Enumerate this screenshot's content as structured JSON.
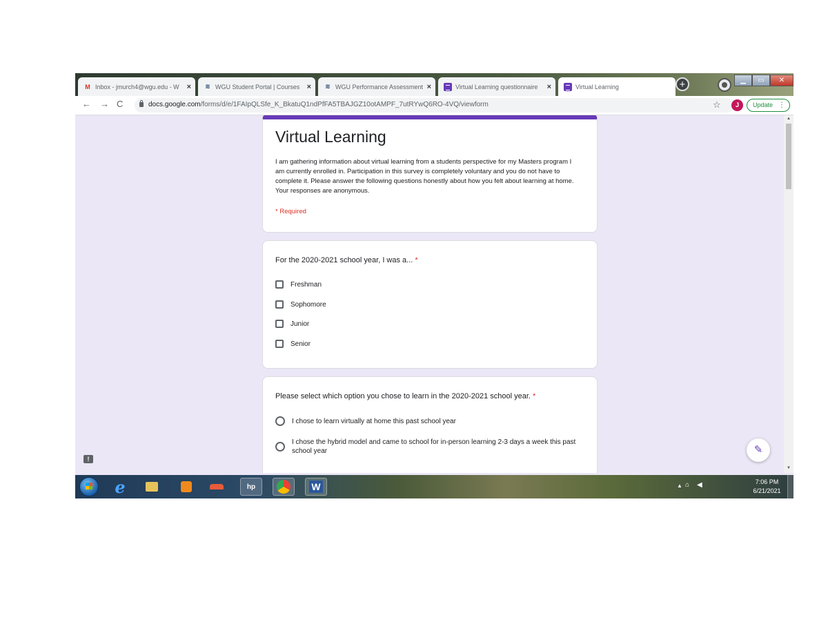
{
  "tabs": [
    {
      "title": "Inbox - jmurch4@wgu.edu - W",
      "icon": "gmail-icon"
    },
    {
      "title": "WGU Student Portal | Courses",
      "icon": "wgu-icon"
    },
    {
      "title": "WGU Performance Assessment",
      "icon": "wgu-icon"
    },
    {
      "title": "Virtual Learning questionnaire",
      "icon": "forms-icon"
    },
    {
      "title": "Virtual Learning",
      "icon": "forms-icon",
      "active": true
    }
  ],
  "tab_close_glyph": "×",
  "address_bar": {
    "domain": "docs.google.com",
    "path": "/forms/d/e/1FAIpQLSfe_K_BkatuQ1ndPfFA5TBAJGZ10otAMPF_7utRYwQ6RO-4VQ/viewform",
    "update_label": "Update",
    "avatar_letter": "J"
  },
  "form": {
    "title": "Virtual Learning",
    "description": "I am gathering information about virtual learning from a students perspective for my Masters program I am currently enrolled in.  Participation in this survey is completely voluntary and you do not have to complete it.  Please answer the following questions honestly about how you felt about learning at home.  Your responses are anonymous.",
    "required_note": "* Required",
    "accent_color": "#673ab7",
    "questions": [
      {
        "title": "For the 2020-2021 school year, I was a...",
        "required_mark": "*",
        "type": "checkbox",
        "options": [
          "Freshman",
          "Sophomore",
          "Junior",
          "Senior"
        ]
      },
      {
        "title": "Please select which option you chose to learn in the 2020-2021 school year.",
        "required_mark": "*",
        "type": "radio",
        "options": [
          "I chose to learn virtually at home this past school year",
          "I chose the hybrid model and came to school for in-person learning 2-3 days a week this past school year"
        ]
      }
    ]
  },
  "taskbar": {
    "hp_label": "hp",
    "word_label": "W",
    "clock_time": "7:06 PM",
    "clock_date": "6/21/2021"
  }
}
